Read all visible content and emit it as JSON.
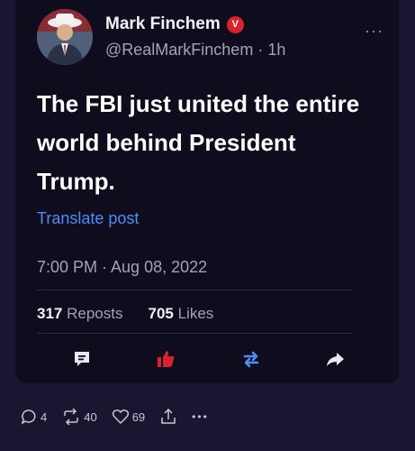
{
  "post": {
    "author_name": "Mark Finchem",
    "verified_badge": "V",
    "handle": "@RealMarkFinchem",
    "separator": "·",
    "age": "1h",
    "more_label": "···",
    "text": "The FBI just united the entire world behind President Trump.",
    "translate_label": "Translate post",
    "timestamp": "7:00 PM · Aug 08, 2022",
    "reposts_count": "317",
    "reposts_label": "Reposts",
    "likes_count": "705",
    "likes_label": "Likes"
  },
  "actions": {
    "comment_icon": "comment-icon",
    "like_icon": "thumbs-up-icon",
    "repost_icon": "repost-icon",
    "share_icon": "share-arrow-icon"
  },
  "bottom_bar": {
    "replies": "4",
    "reposts": "40",
    "likes": "69",
    "more": "•••"
  },
  "colors": {
    "accent_blue": "#4d8ff5",
    "like_red": "#d8232a",
    "background": "#1a1530",
    "card": "#0f0c1e"
  }
}
